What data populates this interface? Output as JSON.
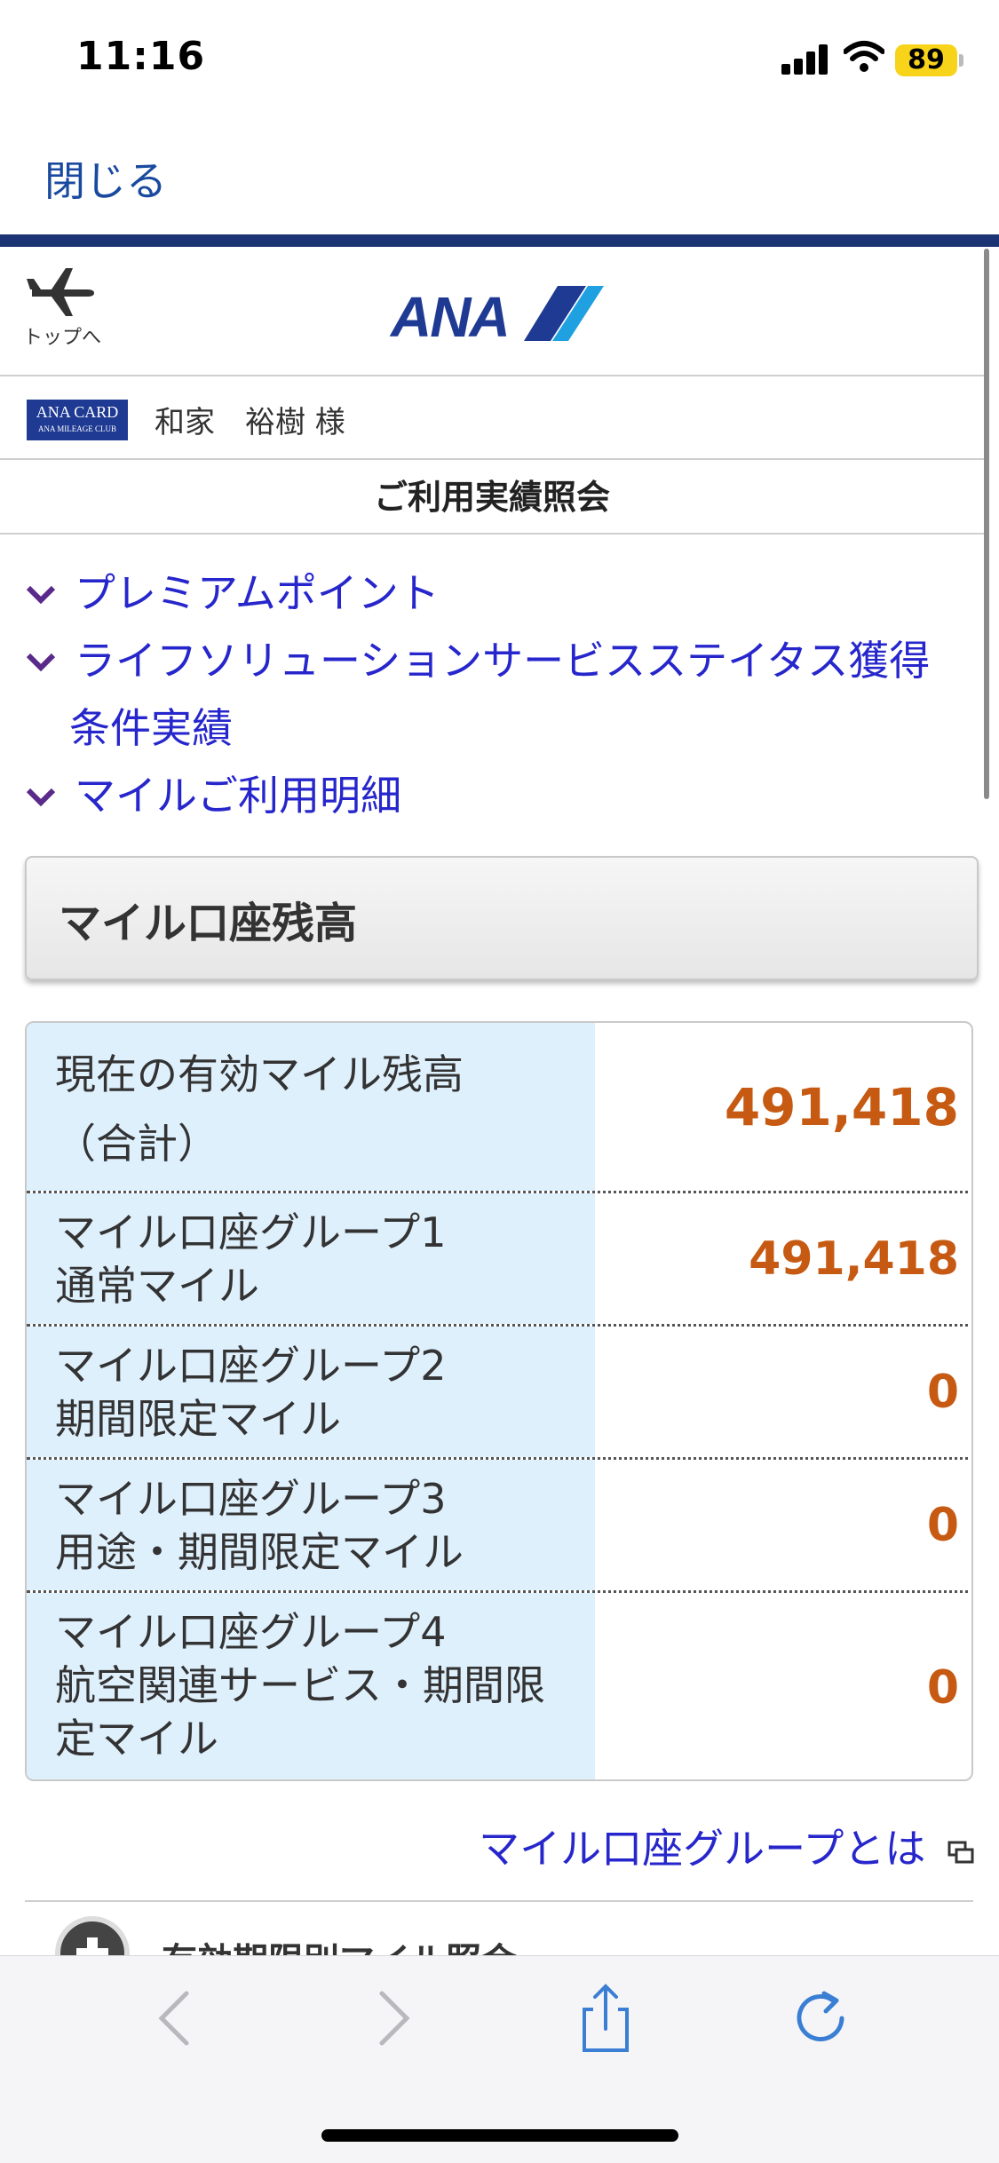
{
  "status": {
    "time": "11:16",
    "battery": "89"
  },
  "nav": {
    "close_label": "閉じる",
    "home_label": "トップへ",
    "logo_text": "ANA"
  },
  "member": {
    "card_line1": "ANA CARD",
    "card_line2": "ANA MILEAGE CLUB",
    "name": "和家　裕樹 様"
  },
  "page_title": "ご利用実績照会",
  "links": [
    {
      "label": "プレミアムポイント"
    },
    {
      "label": "ライフソリューションサービスステイタス獲得",
      "label_cont": "条件実績"
    },
    {
      "label": "マイルご利用明細"
    }
  ],
  "balance": {
    "title": "マイル口座残高",
    "rows": [
      {
        "line1": "現在の有効マイル残高",
        "line2": "（合計）",
        "value": "491,418"
      },
      {
        "line1": "マイル口座グループ1",
        "line2": "通常マイル",
        "value": "491,418"
      },
      {
        "line1": "マイル口座グループ2",
        "line2": "期間限定マイル",
        "value": "0"
      },
      {
        "line1": "マイル口座グループ3",
        "line2": "用途・期間限定マイル",
        "value": "0"
      },
      {
        "line1": "マイル口座グループ4",
        "line2": "航空関連サービス・期間限",
        "line3": "定マイル",
        "value": "0"
      }
    ]
  },
  "group_link": "マイル口座グループとは",
  "expiry_label": "有効期限別マイル照会",
  "colors": {
    "navy": "#1d3474",
    "link": "#2626cc",
    "value": "#c75a12",
    "label_bg": "#dff0fd"
  }
}
